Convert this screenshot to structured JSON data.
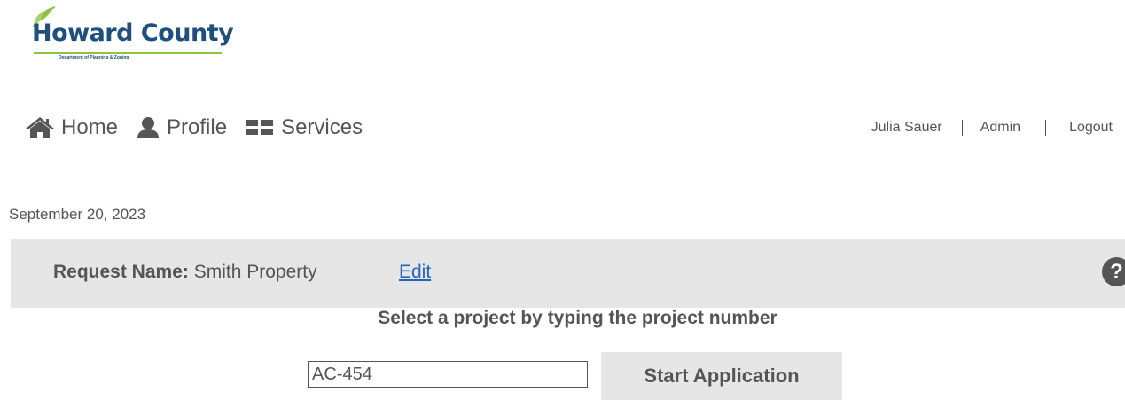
{
  "logo": {
    "title": "Howard County",
    "subtitle": "Department of Planning & Zoning"
  },
  "nav": {
    "items": [
      {
        "label": "Home",
        "icon": "home-icon"
      },
      {
        "label": "Profile",
        "icon": "user-icon"
      },
      {
        "label": "Services",
        "icon": "grid-icon"
      }
    ]
  },
  "user_menu": {
    "user_name": "Julia Sauer",
    "admin": "Admin",
    "logout": "Logout"
  },
  "date": "September 20, 2023",
  "request": {
    "label": "Request Name:",
    "value": "Smith Property",
    "edit": "Edit",
    "help": "?"
  },
  "project_select": {
    "title": "Select a project by typing the project number",
    "input_value": "AC-454",
    "button": "Start Application"
  },
  "colors": {
    "text": "#555555",
    "bar_background": "#e6e6e6",
    "link": "#2266bb",
    "logo_blue": "#1d4f80",
    "logo_green": "#8cc63f"
  }
}
